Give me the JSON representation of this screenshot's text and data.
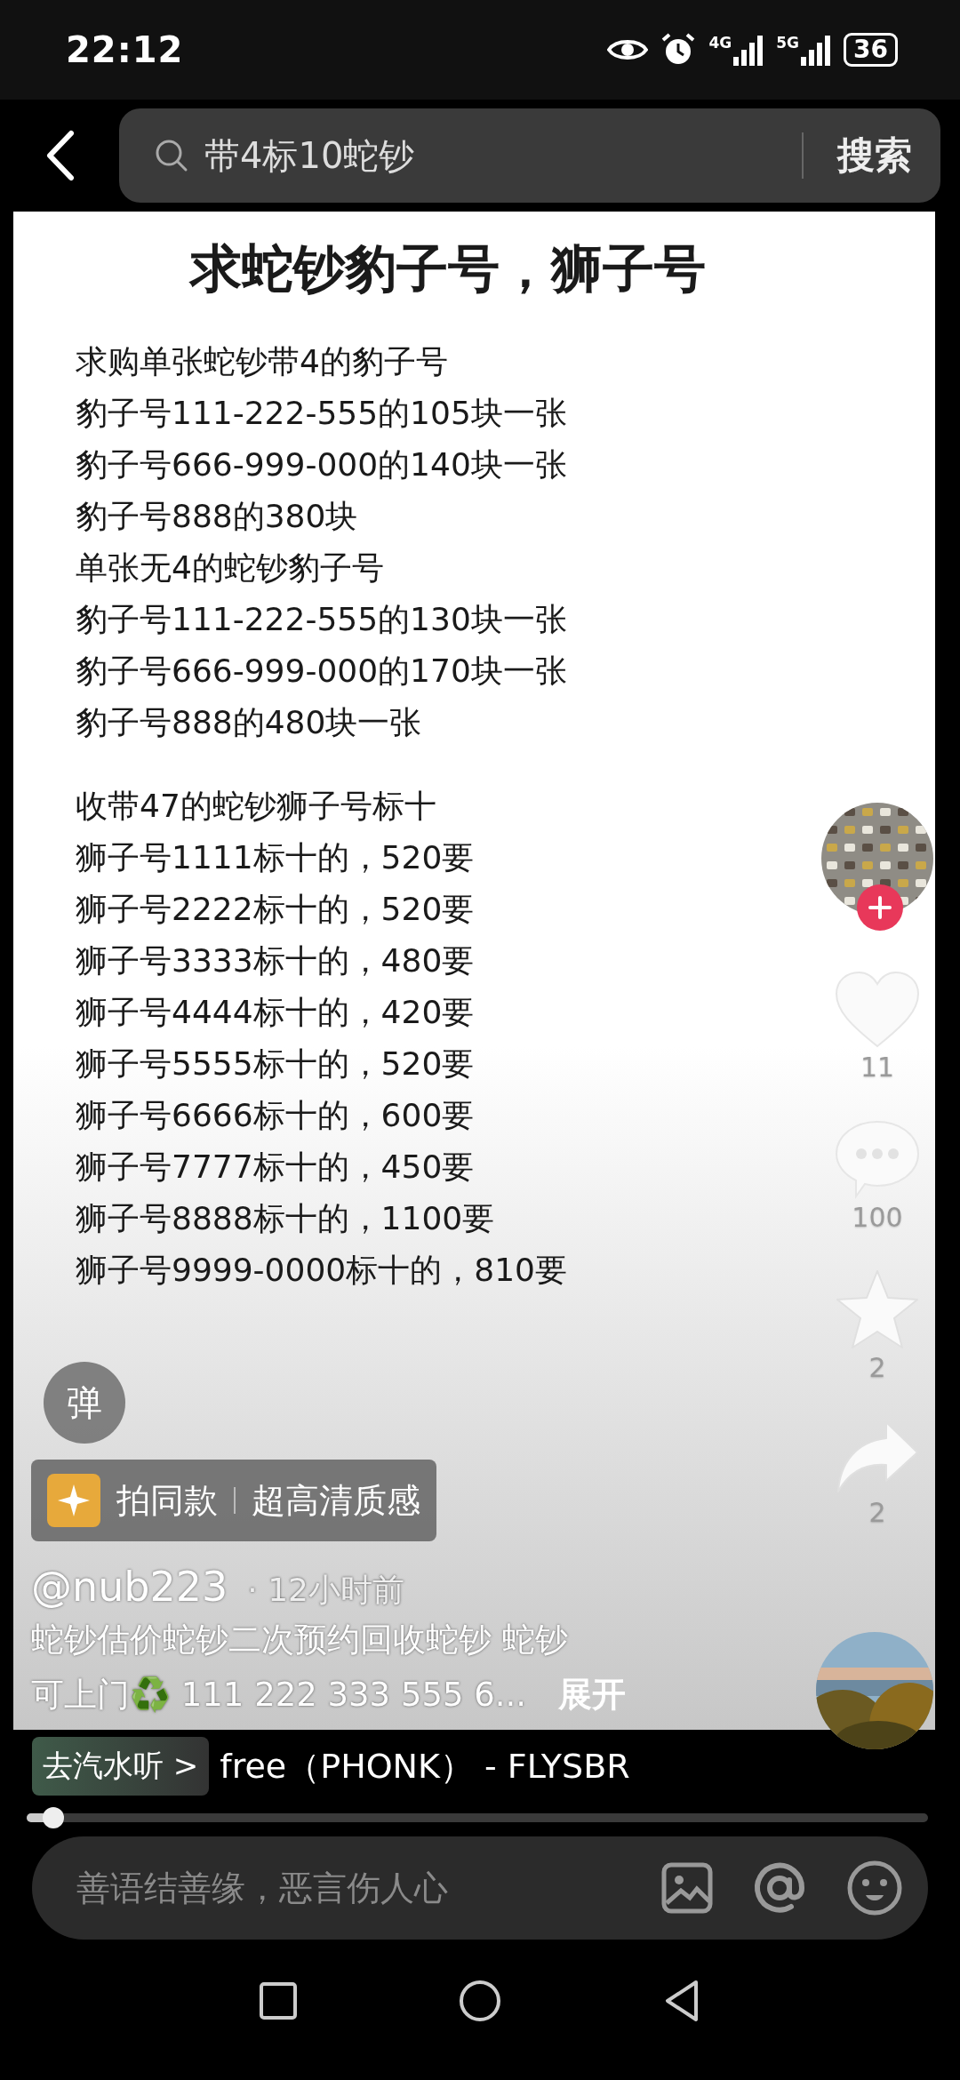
{
  "status_bar": {
    "time": "22:12",
    "network_1": "4G",
    "network_2": "5G",
    "battery": "36"
  },
  "search": {
    "query": "带4标10蛇钞",
    "button": "搜索"
  },
  "video": {
    "document": {
      "title": "求蛇钞豹子号，狮子号",
      "paragraphs": [
        [
          "求购单张蛇钞带4的豹子号",
          "豹子号111-222-555的105块一张",
          "豹子号666-999-000的140块一张",
          "豹子号888的380块",
          "单张无4的蛇钞豹子号",
          "豹子号111-222-555的130块一张",
          "豹子号666-999-000的170块一张",
          "豹子号888的480块一张"
        ],
        [
          "收带47的蛇钞狮子号标十",
          "狮子号1111标十的，520要",
          "狮子号2222标十的，520要",
          "狮子号3333标十的，480要",
          "狮子号4444标十的，420要",
          "狮子号5555标十的，520要",
          "狮子号6666标十的，600要",
          "狮子号7777标十的，450要",
          "狮子号8888标十的，1100要",
          "狮子号9999-0000标十的，810要"
        ]
      ]
    },
    "danmaku_button": "弹",
    "effect_pill": {
      "label": "拍同款",
      "tag": "超高清质感"
    },
    "author": "@nub223",
    "time_ago": "· 12小时前",
    "description": [
      "蛇钞估价蛇钞二次预约回收蛇钞 蛇钞",
      "可上门♻️ 111 222 333 555 6..."
    ],
    "expand": "展开",
    "actions": [
      {
        "kind": "like",
        "count": "11"
      },
      {
        "kind": "comment",
        "count": "100"
      },
      {
        "kind": "favorite",
        "count": "2"
      },
      {
        "kind": "share",
        "count": "2"
      }
    ]
  },
  "music": {
    "tag": "去汽水听 >",
    "title": "free（PHONK） - FLYSBR",
    "level": 0.03
  },
  "comment": {
    "placeholder": "善语结善缘，恶言伤人心"
  }
}
